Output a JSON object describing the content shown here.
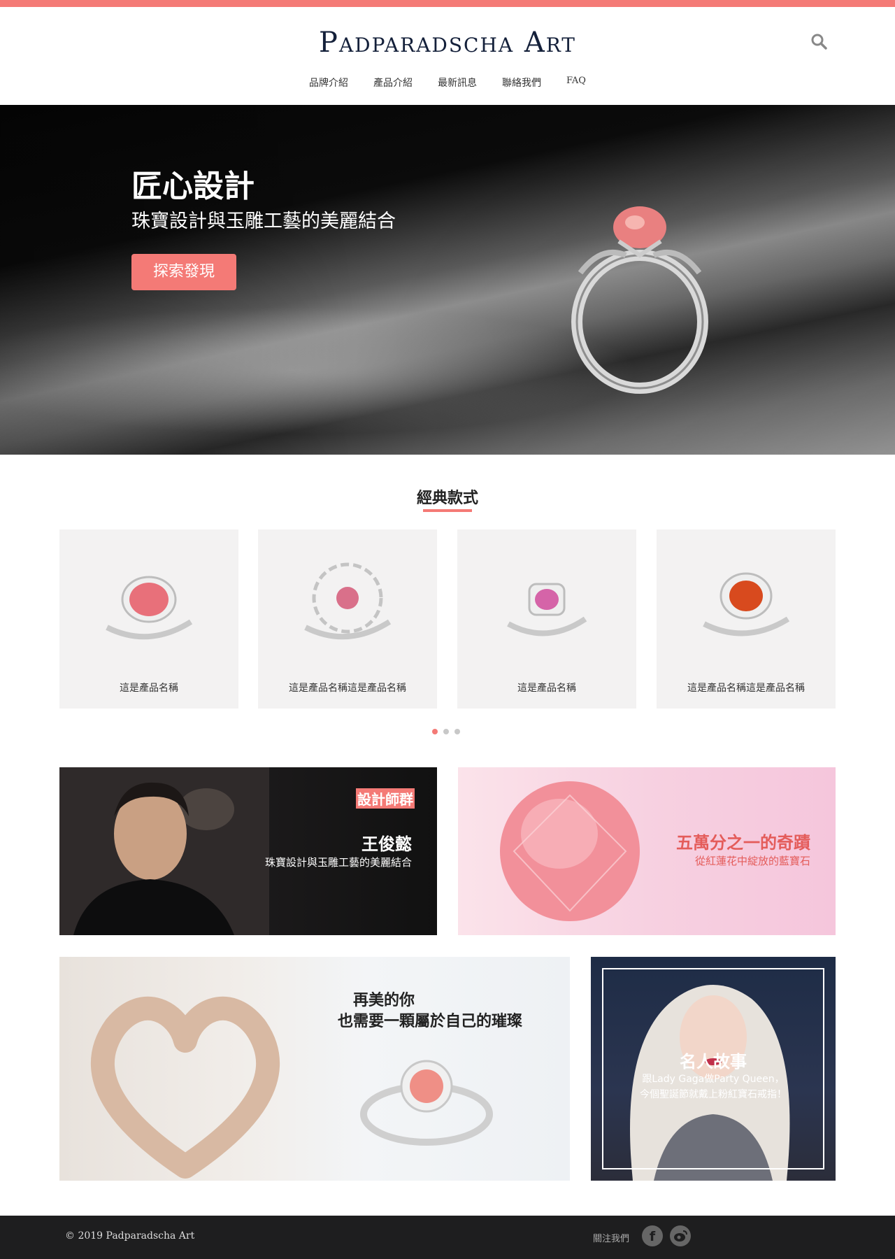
{
  "header": {
    "logo": "Padparadscha Art",
    "nav": [
      "品牌介紹",
      "產品介紹",
      "最新訊息",
      "聯絡我們",
      "FAQ"
    ]
  },
  "hero": {
    "title": "匠心設計",
    "subtitle": "珠寶設計與玉雕工藝的美麗結合",
    "button": "探索發現"
  },
  "classics": {
    "title": "經典款式",
    "products": [
      {
        "name": "這是產品名稱",
        "gem_color": "#e8707a"
      },
      {
        "name": "這是產品名稱這是產品名稱",
        "gem_color": "#d9708a"
      },
      {
        "name": "這是產品名稱",
        "gem_color": "#d564a8"
      },
      {
        "name": "這是產品名稱這是產品名稱",
        "gem_color": "#d84a1e"
      }
    ],
    "pagination": {
      "pages": 3,
      "active": 1
    }
  },
  "banners": {
    "designer": {
      "tag": "設計師群",
      "name": "王俊懿",
      "desc": "珠寶設計與玉雕工藝的美麗結合"
    },
    "gem": {
      "title": "五萬分之一的奇蹟",
      "sub": "從紅蓮花中綻放的藍寶石"
    },
    "love": {
      "line1": "再美的你",
      "line2": "也需要一顆屬於自己的璀璨"
    },
    "celebrity": {
      "title": "名人故事",
      "line1": "跟Lady Gaga做Party Queen，",
      "line2": "今個聖誕節就戴上粉紅寶石戒指！"
    }
  },
  "footer": {
    "copyright": "© 2019 Padparadscha Art",
    "follow": "關注我們",
    "social": [
      "facebook-icon",
      "weibo-icon"
    ]
  },
  "colors": {
    "accent": "#f47a76",
    "navy": "#14203a",
    "footer": "#1e1e1f"
  }
}
